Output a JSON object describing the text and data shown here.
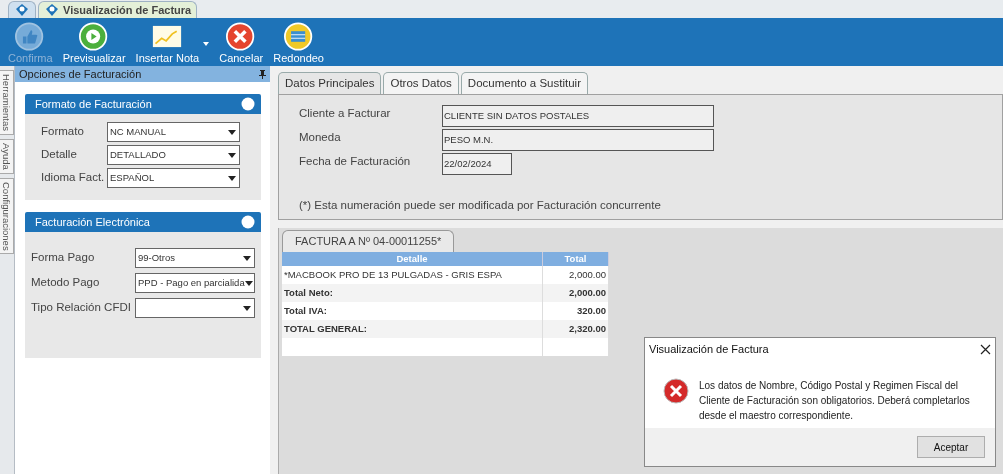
{
  "window_tabs": [
    {
      "selected": false
    },
    {
      "label": "Visualización de Factura",
      "selected": true
    }
  ],
  "toolbar": [
    {
      "label": "Confirma",
      "kind": "confirm",
      "disabled": true,
      "dropdown": false
    },
    {
      "label": "Previsualizar",
      "kind": "preview",
      "disabled": false,
      "dropdown": false
    },
    {
      "label": "Insertar Nota",
      "kind": "note",
      "disabled": false,
      "dropdown": true
    },
    {
      "label": "Cancelar",
      "kind": "cancel",
      "disabled": false,
      "dropdown": false
    },
    {
      "label": "Redondeo",
      "kind": "round",
      "disabled": false,
      "dropdown": false
    }
  ],
  "side_tabs": [
    "Herramientas",
    "Ayuda",
    "Configuraciones"
  ],
  "options_panel": {
    "title": "Opciones de Facturación",
    "groups": [
      {
        "title": "Formato de Facturación",
        "fields": [
          {
            "label": "Formato",
            "value": "NC MANUAL"
          },
          {
            "label": "Detalle",
            "value": "DETALLADO"
          },
          {
            "label": "Idioma Fact.",
            "value": "ESPAÑOL"
          }
        ]
      },
      {
        "title": "Facturación Electrónica",
        "fields": [
          {
            "label": "Forma Pago",
            "value": "99-Otros"
          },
          {
            "label": "Metodo Pago",
            "value": "PPD - Pago en parcialida"
          },
          {
            "label": "Tipo Relación CFDI"
          }
        ]
      }
    ]
  },
  "main_tabs": [
    {
      "label": "Datos Principales",
      "selected": true
    },
    {
      "label": "Otros Datos",
      "selected": false
    },
    {
      "label": "Documento a Sustituir",
      "selected": false
    }
  ],
  "main_fields": [
    {
      "label": "Cliente a Facturar",
      "value": "CLIENTE SIN DATOS POSTALES"
    },
    {
      "label": "Moneda",
      "value": "PESO M.N."
    },
    {
      "label": "Fecha de Facturación",
      "value": "22/02/2024"
    }
  ],
  "note": "(*) Esta numeración puede ser modificada por Facturación concurrente",
  "invoice": {
    "tab": "FACTURA A Nº 04-00011255*",
    "columns": [
      "Detalle",
      "Total"
    ],
    "rows": [
      {
        "kind": "item",
        "detail": "*MACBOOK PRO DE 13 PULGADAS - GRIS ESPA",
        "total": "2,000.00"
      },
      {
        "kind": "total",
        "detail": "Total Neto:",
        "total": "2,000.00"
      },
      {
        "kind": "total",
        "detail": "Total IVA:",
        "total": "320.00"
      },
      {
        "kind": "total",
        "detail": "TOTAL GENERAL:",
        "total": "2,320.00"
      },
      {
        "kind": "empty"
      }
    ]
  },
  "dialog": {
    "title": "Visualización de Factura",
    "message": "Los datos de Nombre, Código Postal y Regimen Fiscal del Cliente de Facturación son obligatorios. Deberá completarlos desde el maestro correspondiente.",
    "button": "Aceptar"
  }
}
